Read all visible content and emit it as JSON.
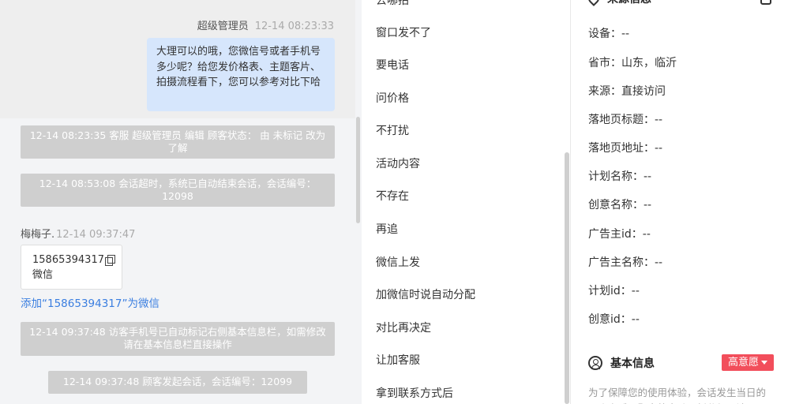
{
  "chat": {
    "outgoing": {
      "sender": "超级管理员",
      "time": "12-14 08:23:33",
      "text": "大理可以的哦，您微信号或者手机号多少呢？给您发价格表、主题客片、拍摄流程看下，您可以参考对比下哈"
    },
    "system_messages": [
      "12-14 08:23:35 客服 超级管理员 编辑 顾客状态： 由 未标记 改为 了解",
      "12-14 08:53:08 会话超时，系统已自动结束会话，会话编号：12098",
      "12-14 09:37:48 访客手机号已自动标记右侧基本信息栏，如需修改请在基本信息栏直接操作",
      "12-14 09:37:48 顾客发起会话，会话编号：12099"
    ],
    "incoming": {
      "sender": "梅梅子.",
      "time": "12-14 09:37:47",
      "card_number": "15865394317",
      "card_type": "微信"
    },
    "add_link": "添加“15865394317”为微信"
  },
  "quick_replies": [
    "去哪拍",
    "窗口发不了",
    "要电话",
    "问价格",
    "不打扰",
    "活动内容",
    "不存在",
    "再追",
    "微信上发",
    "加微信时说自动分配",
    "对比再决定",
    "让加客服",
    "拿到联系方式后"
  ],
  "info": {
    "source_title": "来源信息",
    "fields": [
      "设备：--",
      "省市：山东，临沂",
      "来源：直接访问",
      "落地页标题：--",
      "落地页地址：--",
      "计划名称：--",
      "创意名称：--",
      "广告主id：--",
      "广告主名称：--",
      "计划id：--",
      "创意id：--"
    ],
    "basic_title": "基本信息",
    "intent_badge": "高意愿",
    "notice": "为了保障您的使用体验，会话发生当日的一个之后，顾客将自动更新分组，请",
    "colors": {
      "badge": "#f24e5b",
      "link": "#3a7ee0",
      "bubble": "#d6e6fc"
    }
  }
}
